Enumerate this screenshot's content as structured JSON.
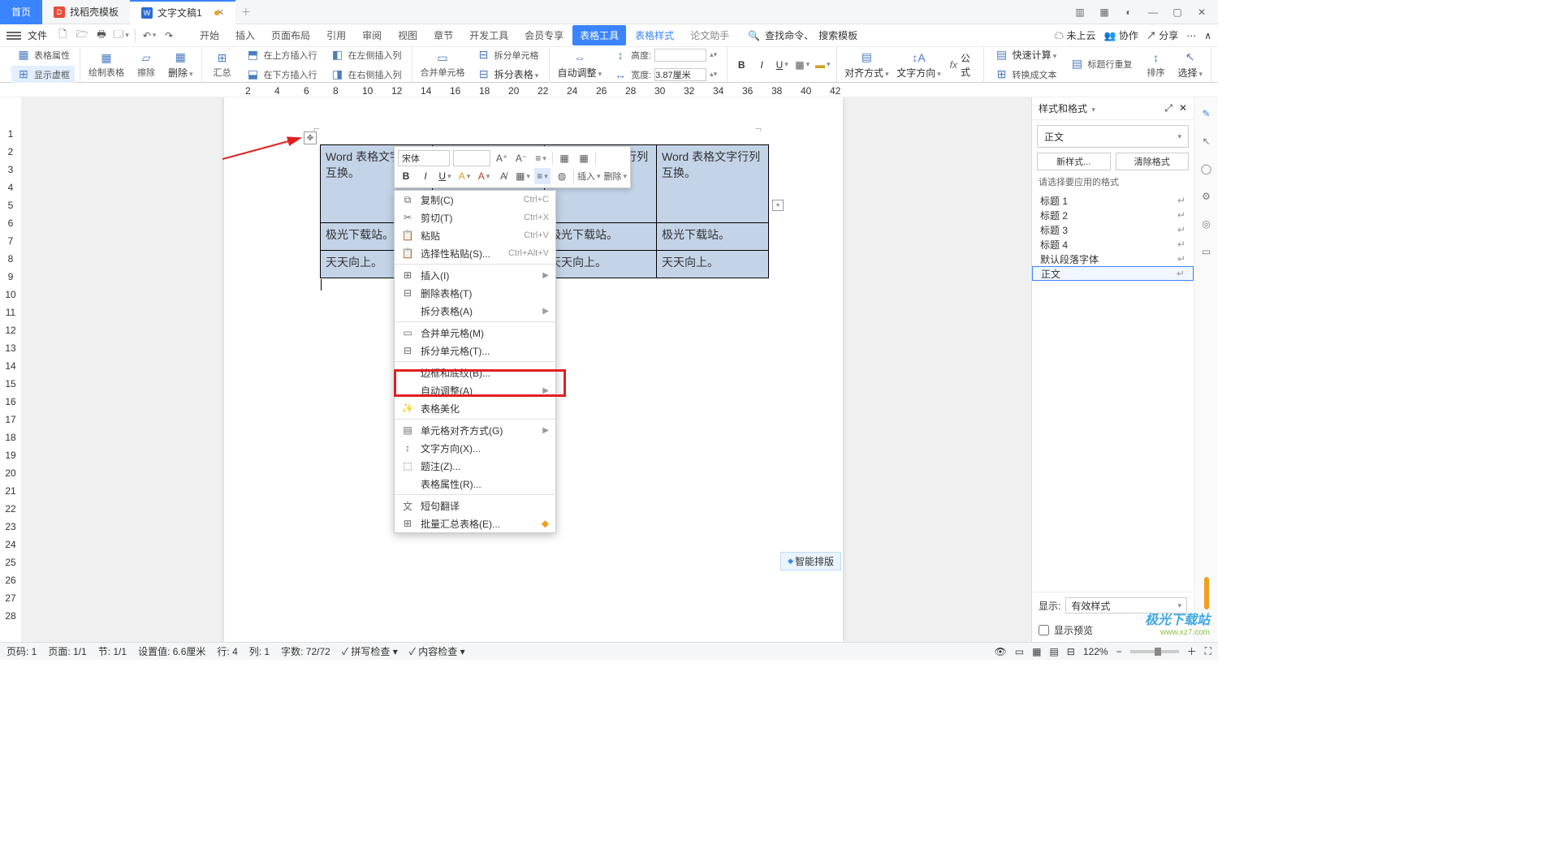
{
  "tabs": {
    "home": "首页",
    "templates": "找稻壳模板",
    "doc": "文字文稿1"
  },
  "menu": {
    "file": "文件",
    "tabs": [
      "开始",
      "插入",
      "页面布局",
      "引用",
      "审阅",
      "视图",
      "章节",
      "开发工具",
      "会员专享"
    ],
    "active": "表格工具",
    "sub1": "表格样式",
    "sub2": "论文助手",
    "search_ph1": "查找命令、",
    "search_ph2": "搜索模板",
    "right": {
      "cloud": "未上云",
      "coop": "协作",
      "share": "分享"
    }
  },
  "ribbon": {
    "g1a": "表格属性",
    "g1b": "显示虚框",
    "g2a": "绘制表格",
    "g2b": "擦除",
    "g2c": "删除",
    "g2c_dd": "▾",
    "g3a": "汇总",
    "g3b": "在上方插入行",
    "g3c": "在下方插入行",
    "g3d": "在左侧插入列",
    "g3e": "在右侧插入列",
    "g4a": "合并单元格",
    "g4b": "拆分单元格",
    "g4c": "拆分表格",
    "g5a": "自动调整",
    "g5b": "高度:",
    "g5c": "宽度:",
    "g5c_val": "3.87厘米",
    "g6a": "对齐方式",
    "g6b": "文字方向",
    "g6c": "公式",
    "g7a": "快速计算",
    "g7b": "标题行重复",
    "g7c": "转换成文本",
    "g7d": "排序",
    "g7e": "选择"
  },
  "table": {
    "cell": "Word 表格文字行列互换。",
    "row2": "极光下载站。",
    "row3": "天天向上。"
  },
  "float": {
    "font": "宋体"
  },
  "ctx": {
    "copy": "复制(C)",
    "copy_sc": "Ctrl+C",
    "cut": "剪切(T)",
    "cut_sc": "Ctrl+X",
    "paste": "粘贴",
    "paste_sc": "Ctrl+V",
    "pastesp": "选择性粘贴(S)...",
    "pastesp_sc": "Ctrl+Alt+V",
    "insert": "插入(I)",
    "deltable": "删除表格(T)",
    "split_table": "拆分表格(A)",
    "merge": "合并单元格(M)",
    "split_cell": "拆分单元格(T)...",
    "border": "边框和底纹(B)...",
    "autofit": "自动调整(A)",
    "beautify": "表格美化",
    "align": "单元格对齐方式(G)",
    "textdir": "文字方向(X)...",
    "caption": "题注(Z)...",
    "tblprops": "表格属性(R)...",
    "translate": "短句翻译",
    "batch": "批量汇总表格(E)..."
  },
  "panel": {
    "title": "样式和格式",
    "current": "正文",
    "new": "新样式...",
    "clear": "清除格式",
    "hint": "请选择要应用的格式",
    "items": [
      "标题 1",
      "标题 2",
      "标题 3",
      "标题 4",
      "默认段落字体",
      "正文"
    ],
    "show": "显示:",
    "show_val": "有效样式",
    "preview": "显示预览"
  },
  "status": {
    "page": "页码: 1",
    "pages": "页面: 1/1",
    "sec": "节: 1/1",
    "setval": "设置值: 6.6厘米",
    "row": "行: 4",
    "col": "列: 1",
    "words": "字数: 72/72",
    "spell": "拼写检查",
    "content": "内容检查",
    "zoom": "122%",
    "smart": "智能排版"
  },
  "logo": {
    "l1": "极光下载站",
    "l2": "www.xz7.com"
  }
}
